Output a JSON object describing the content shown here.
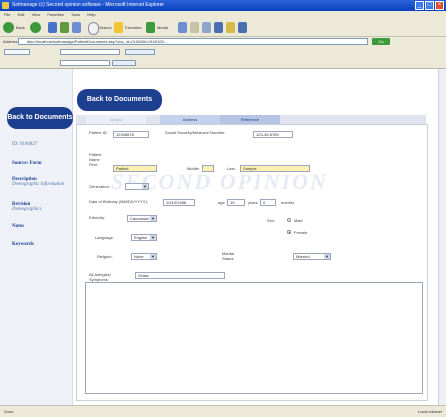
{
  "window": {
    "title": "Sofmanage (c) Second opinion software - Microsoft Internet Explorer"
  },
  "menu": [
    "File",
    "Edit",
    "View",
    "Favorites",
    "Tools",
    "Help"
  ],
  "toolbar": {
    "back_label": "Back",
    "search_label": "Search",
    "favorites_label": "Favorites",
    "media_label": "Media"
  },
  "address": {
    "label": "Address",
    "value": "http://localhost/sofmanage/PatientDocuments.asp?doc_id=0100&fil=0100100...",
    "go_label": "Go"
  },
  "sidebar": {
    "back_button": "Back to Documents",
    "id_label": "ID: 0100827",
    "links": [
      {
        "title": "Source: Form"
      },
      {
        "title": "Description",
        "sub": "Demographic information"
      },
      {
        "title": "Revision",
        "sub": "Demographics"
      },
      {
        "title": "Notes"
      },
      {
        "title": "Keywords"
      }
    ]
  },
  "main": {
    "back_button": "Back to Documents",
    "tabs": [
      "Subject",
      "Address",
      "Reference"
    ],
    "form": {
      "patient_id_label": "Patient ID:",
      "patient_id_value": "12345678",
      "ssn_label": "Social Security/Medicare Number:",
      "ssn_value": "123-45-6789",
      "name_label": "Patient Name First:",
      "first_value": "Patient",
      "middle_label": "Middle:",
      "middle_value": "",
      "last_label": "Last:",
      "last_value": "Sample",
      "generation_label": "Generation:",
      "generation_value": "",
      "dob_label": "Date of Birthday (MM/DD/YYYY):",
      "dob_value": "10/10/1986",
      "age_label": "age",
      "age_years": "19",
      "years_label": "years",
      "age_months": "0",
      "months_label": "months",
      "ethnicity_label": "Ethnicity:",
      "ethnicity_value": "Caucasian",
      "sex_label": "Sex:",
      "male_label": "Male",
      "female_label": "Female",
      "language_label": "Language:",
      "language_value": "English",
      "religion_label": "Religion:",
      "religion_value": "None",
      "marital_label": "Marital Status:",
      "marital_value": "Married",
      "allergies_label": "All Allergies/ Symptoms Notes:",
      "allergies_value": "Grass"
    },
    "watermark": "SECOND OPINION"
  },
  "status": {
    "left": "Done",
    "right": "Local intranet"
  }
}
